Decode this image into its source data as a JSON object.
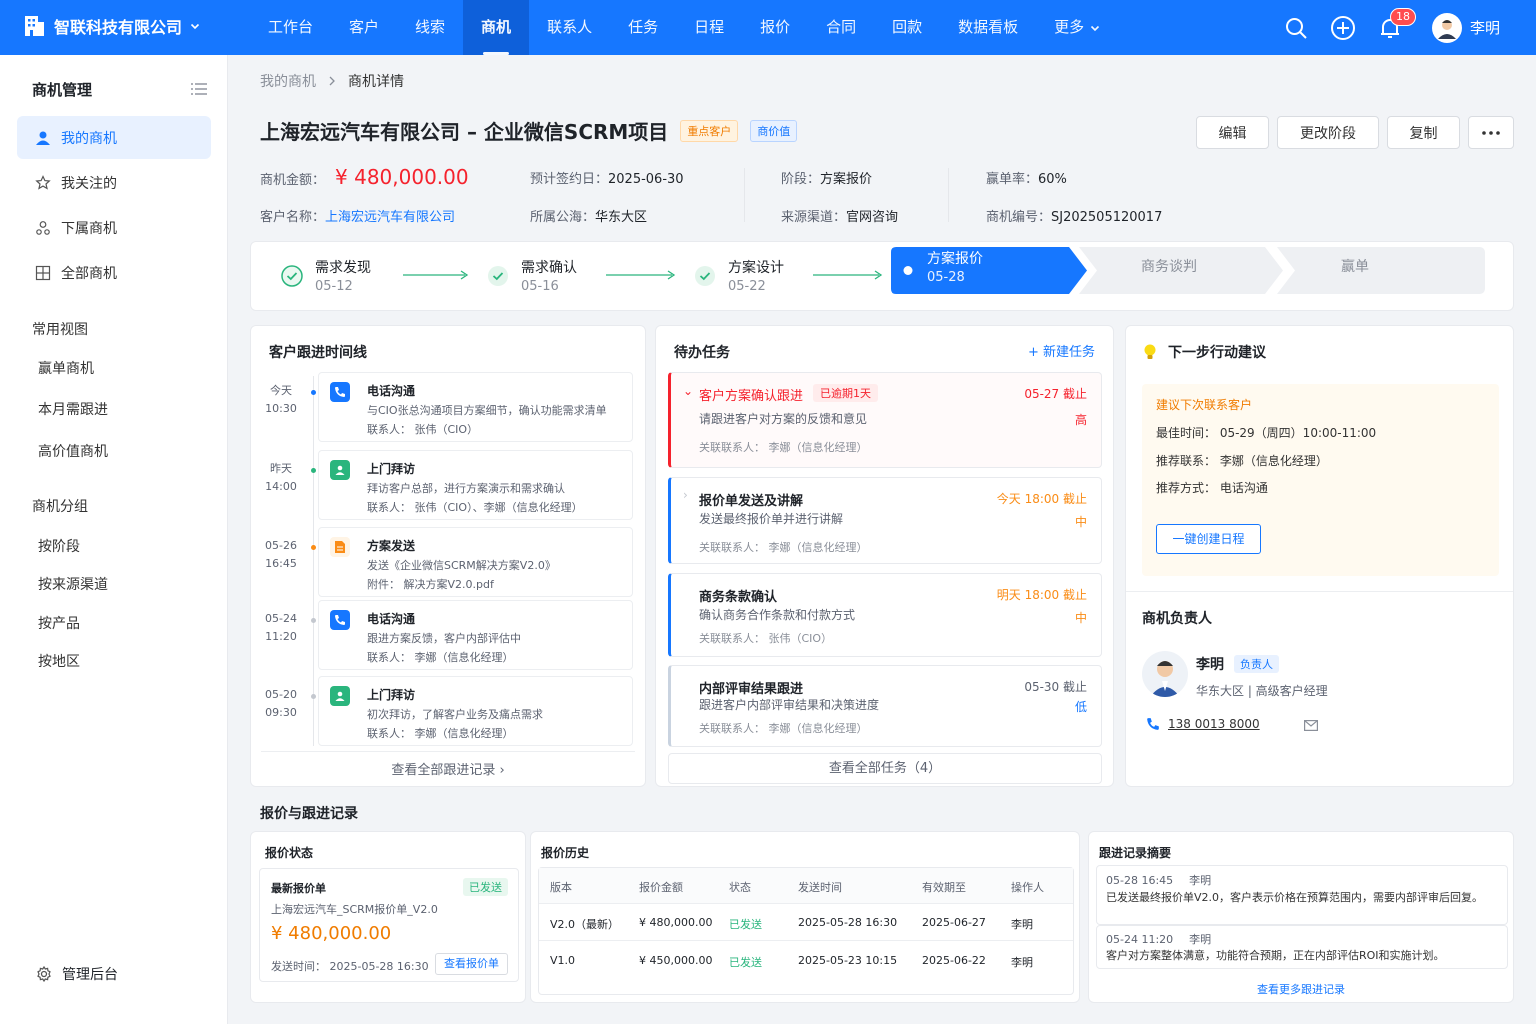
{
  "topbar": {
    "company": "智联科技有限公司",
    "nav": [
      "工作台",
      "客户",
      "线索",
      "商机",
      "联系人",
      "任务",
      "日程",
      "报价",
      "合同",
      "回款",
      "数据看板",
      "更多"
    ],
    "active_nav": "商机",
    "notification_count": "18",
    "user_name": "李明"
  },
  "sidebar": {
    "title": "商机管理",
    "items": [
      "我的商机",
      "我关注的",
      "下属商机",
      "全部商机"
    ],
    "views_title": "常用视图",
    "views": [
      "赢单商机",
      "本月需跟进",
      "高价值商机"
    ],
    "groups_title": "商机分组",
    "groups": [
      "按阶段",
      "按来源渠道",
      "按产品",
      "按地区"
    ],
    "admin": "管理后台"
  },
  "breadcrumb": {
    "parent": "我的商机",
    "current": "商机详情"
  },
  "header": {
    "title": "上海宏远汽车有限公司 – 企业微信SCRM项目",
    "tag1": "重点客户",
    "tag2": "商价值",
    "actions": [
      "编辑",
      "更改阶段",
      "复制"
    ]
  },
  "info": {
    "amount_label": "商机金额：",
    "amount": "¥ 480,000.00",
    "sign_label": "预计签约日：",
    "sign_date": "2025-06-30",
    "stage_label": "阶段：",
    "stage": "方案报价",
    "win_label": "赢单率：",
    "win_rate": "60%",
    "customer_label": "客户名称：",
    "customer": "上海宏远汽车有限公司",
    "pool_label": "所属公海：",
    "pool": "华东大区",
    "source_label": "来源渠道：",
    "source": "官网咨询",
    "no_label": "商机编号：",
    "no": "SJ202505120017"
  },
  "stages": [
    {
      "name": "需求发现",
      "date": "05-12",
      "status": "done"
    },
    {
      "name": "需求确认",
      "date": "05-16",
      "status": "done"
    },
    {
      "name": "方案设计",
      "date": "05-22",
      "status": "done"
    },
    {
      "name": "方案报价",
      "date": "05-28",
      "status": "current"
    },
    {
      "name": "商务谈判",
      "date": "",
      "status": "todo"
    },
    {
      "name": "赢单",
      "date": "",
      "status": "todo"
    }
  ],
  "timeline": {
    "title": "客户跟进时间线",
    "items": [
      {
        "day": "今天",
        "time": "10:30",
        "type": "电话沟通",
        "desc": "与CIO张总沟通项目方案细节，确认功能需求清单",
        "contact": "联系人： 张伟（CIO）"
      },
      {
        "day": "昨天",
        "time": "14:00",
        "type": "上门拜访",
        "desc": "拜访客户总部，进行方案演示和需求确认",
        "contact": "联系人： 张伟（CIO）、李娜（信息化经理）"
      },
      {
        "day": "05-26",
        "time": "16:45",
        "type": "方案发送",
        "desc": "发送《企业微信SCRM解决方案V2.0》",
        "contact": "附件： 解决方案V2.0.pdf"
      },
      {
        "day": "05-24",
        "time": "11:20",
        "type": "电话沟通",
        "desc": "跟进方案反馈，客户内部评估中",
        "contact": "联系人： 李娜（信息化经理）"
      },
      {
        "day": "05-20",
        "time": "09:30",
        "type": "上门拜访",
        "desc": "初次拜访，了解客户业务及痛点需求",
        "contact": "联系人： 李娜（信息化经理）"
      }
    ],
    "more": "查看全部跟进记录"
  },
  "tasks": {
    "title": "待办任务",
    "new": "新建任务",
    "items": [
      {
        "title": "客户方案确认跟进",
        "overdue": "已逾期1天",
        "desc": "请跟进客户对方案的反馈和意见",
        "contact": "关联联系人： 李娜（信息化经理）",
        "due": "05-27 截止",
        "priority": "高",
        "color": "#f5222d"
      },
      {
        "title": "报价单发送及讲解",
        "overdue": "",
        "desc": "发送最终报价单并进行讲解",
        "contact": "关联联系人： 李娜（信息化经理）",
        "due": "今天 18:00 截止",
        "priority": "中",
        "color": "#fa8c16"
      },
      {
        "title": "商务条款确认",
        "overdue": "",
        "desc": "确认商务合作条款和付款方式",
        "contact": "关联联系人： 张伟（CIO）",
        "due": "明天 18:00 截止",
        "priority": "中",
        "color": "#fa8c16"
      },
      {
        "title": "内部评审结果跟进",
        "overdue": "",
        "desc": "跟进客户内部评审结果和决策进度",
        "contact": "关联联系人： 李娜（信息化经理）",
        "due": "05-30 截止",
        "priority": "低",
        "color": "#1677ff"
      }
    ],
    "more": "查看全部任务（4）"
  },
  "suggestion": {
    "title": "下一步行动建议",
    "head": "建议下次联系客户",
    "time": "最佳时间： 05-29（周四）10:00-11:00",
    "contact": "推荐联系： 李娜（信息化经理）",
    "method": "推荐方式： 电话沟通",
    "button": "一键创建日程"
  },
  "owner": {
    "title": "商机负责人",
    "name": "李明",
    "role_tag": "负责人",
    "dept": "华东大区 | 高级客户经理",
    "phone": "138 0013 8000"
  },
  "quote_section": {
    "title": "报价与跟进记录",
    "status_title": "报价状态",
    "latest": "最新报价单",
    "latest_status": "已发送",
    "file": "上海宏远汽车_SCRM报价单_V2.0",
    "amount": "¥ 480,000.00",
    "sent_time": "发送时间： 2025-05-28 16:30",
    "view_btn": "查看报价单",
    "history_title": "报价历史",
    "columns": [
      "版本",
      "报价金额",
      "状态",
      "发送时间",
      "有效期至",
      "操作人"
    ],
    "rows": [
      [
        "V2.0（最新）",
        "¥ 480,000.00",
        "已发送",
        "2025-05-28 16:30",
        "2025-06-27",
        "李明"
      ],
      [
        "V1.0",
        "¥ 450,000.00",
        "已发送",
        "2025-05-23 10:15",
        "2025-06-22",
        "李明"
      ]
    ],
    "log_title": "跟进记录摘要",
    "logs": [
      {
        "time": "05-28 16:45",
        "user": "李明",
        "text": "已发送最终报价单V2.0，客户表示价格在预算范围内，需要内部评审后回复。"
      },
      {
        "time": "05-24 11:20",
        "user": "李明",
        "text": "客户对方案整体满意，功能符合预期，正在内部评估ROI和实施计划。"
      }
    ],
    "log_more": "查看更多跟进记录"
  }
}
